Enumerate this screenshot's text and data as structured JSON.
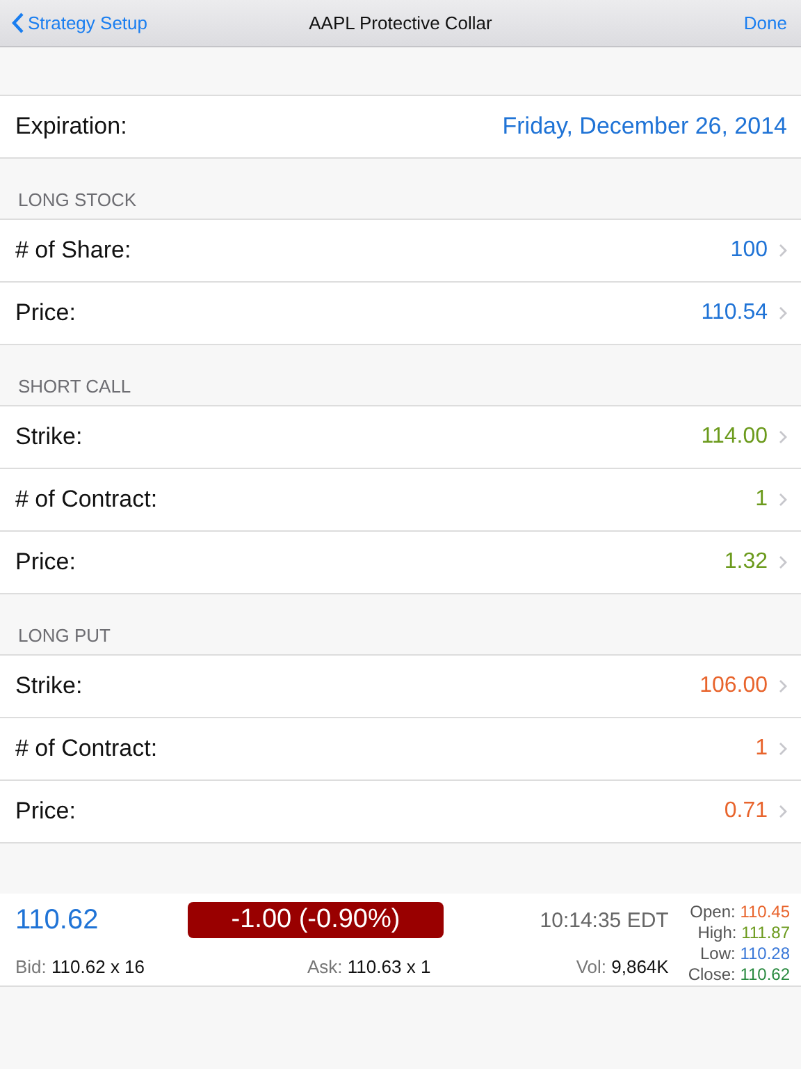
{
  "nav": {
    "back": "Strategy Setup",
    "title": "AAPL Protective Collar",
    "done": "Done"
  },
  "expiration": {
    "label": "Expiration:",
    "value": "Friday, December 26, 2014"
  },
  "sections": [
    {
      "header": "LONG STOCK",
      "color": "#1f73d6",
      "rows": [
        {
          "label": "# of Share:",
          "value": "100"
        },
        {
          "label": "Price:",
          "value": "110.54"
        }
      ]
    },
    {
      "header": "SHORT CALL",
      "color": "#6b9a1c",
      "rows": [
        {
          "label": "Strike:",
          "value": "114.00"
        },
        {
          "label": "# of Contract:",
          "value": "1"
        },
        {
          "label": "Price:",
          "value": "1.32"
        }
      ]
    },
    {
      "header": "LONG PUT",
      "color": "#e8642c",
      "rows": [
        {
          "label": "Strike:",
          "value": "106.00"
        },
        {
          "label": "# of Contract:",
          "value": "1"
        },
        {
          "label": "Price:",
          "value": "0.71"
        }
      ]
    }
  ],
  "quote": {
    "last": "110.62",
    "change": "-1.00 (-0.90%)",
    "time": "10:14:35 EDT",
    "bid_label": "Bid:",
    "bid": "110.62 x 16",
    "ask_label": "Ask:",
    "ask": "110.63 x 1",
    "vol_label": "Vol:",
    "vol": "9,864K",
    "stats": [
      {
        "label": "Open:",
        "value": "110.45",
        "color": "#e8642c"
      },
      {
        "label": "High:",
        "value": "111.87",
        "color": "#6b9a1c"
      },
      {
        "label": "Low:",
        "value": "110.28",
        "color": "#3a78d8"
      },
      {
        "label": "Close:",
        "value": "110.62",
        "color": "#2a8a40"
      }
    ]
  }
}
